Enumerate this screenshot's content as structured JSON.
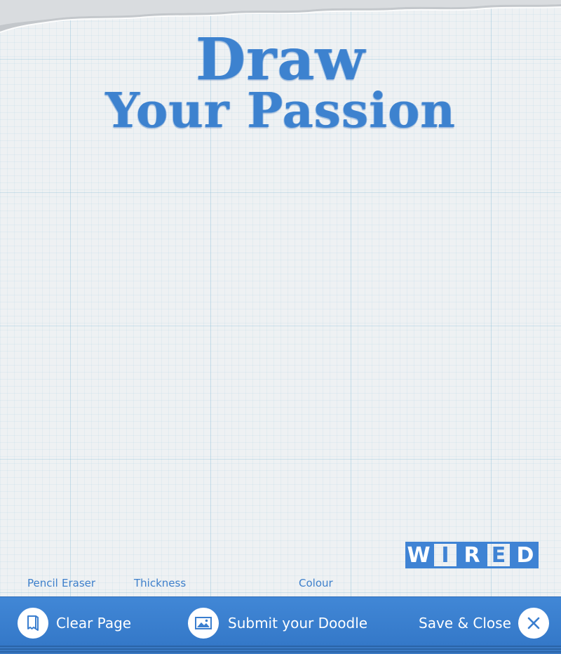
{
  "title": {
    "line1": "Draw",
    "line2": "Your Passion"
  },
  "tools": {
    "pencil": "Pencil",
    "eraser": "Eraser",
    "thickness": "Thickness",
    "colour": "Colour"
  },
  "logo": {
    "letters": [
      "W",
      "I",
      "R",
      "E",
      "D"
    ]
  },
  "toolbar": {
    "clear_label": "Clear Page",
    "submit_label": "Submit your Doodle",
    "close_label": "Save & Close"
  },
  "icons": {
    "clear": "page-icon",
    "submit": "image-icon",
    "close": "close-icon"
  },
  "colors": {
    "accent": "#3d82cf",
    "toolbar": "#3a7ecf",
    "paper": "#eef1f3"
  }
}
